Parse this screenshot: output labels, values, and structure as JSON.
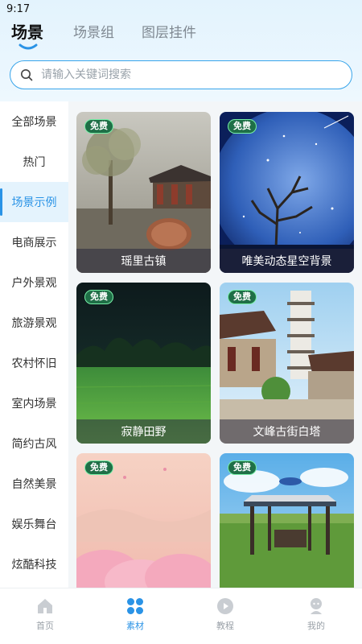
{
  "status_bar": {
    "time": "9:17"
  },
  "tabs": [
    {
      "label": "场景",
      "active": true
    },
    {
      "label": "场景组",
      "active": false
    },
    {
      "label": "图层挂件",
      "active": false
    }
  ],
  "search": {
    "placeholder": "请输入关键词搜索",
    "value": "",
    "icon": "search-icon"
  },
  "sidebar": {
    "items": [
      {
        "label": "全部场景"
      },
      {
        "label": "热门"
      },
      {
        "label": "场景示例",
        "active": true
      },
      {
        "label": "电商展示"
      },
      {
        "label": "户外景观"
      },
      {
        "label": "旅游景观"
      },
      {
        "label": "农村怀旧"
      },
      {
        "label": "室内场景"
      },
      {
        "label": "简约古风"
      },
      {
        "label": "自然美景"
      },
      {
        "label": "娱乐舞台"
      },
      {
        "label": "炫酷科技"
      }
    ]
  },
  "cards": [
    {
      "title": "瑶里古镇",
      "badge": "免费"
    },
    {
      "title": "唯美动态星空背景",
      "badge": "免费"
    },
    {
      "title": "寂静田野",
      "badge": "免费"
    },
    {
      "title": "文峰古街白塔",
      "badge": "免费"
    },
    {
      "title": "",
      "badge": "免费"
    },
    {
      "title": "",
      "badge": "免费"
    }
  ],
  "bottom_nav": [
    {
      "label": "首页",
      "icon": "home-icon"
    },
    {
      "label": "素材",
      "icon": "material-icon",
      "active": true
    },
    {
      "label": "教程",
      "icon": "play-icon"
    },
    {
      "label": "我的",
      "icon": "profile-icon"
    }
  ],
  "colors": {
    "accent": "#2a93e6",
    "badge_bg": "#1f6f47",
    "badge_border": "#78f0a8",
    "sidebar_active_bg": "#e4f3fd"
  }
}
